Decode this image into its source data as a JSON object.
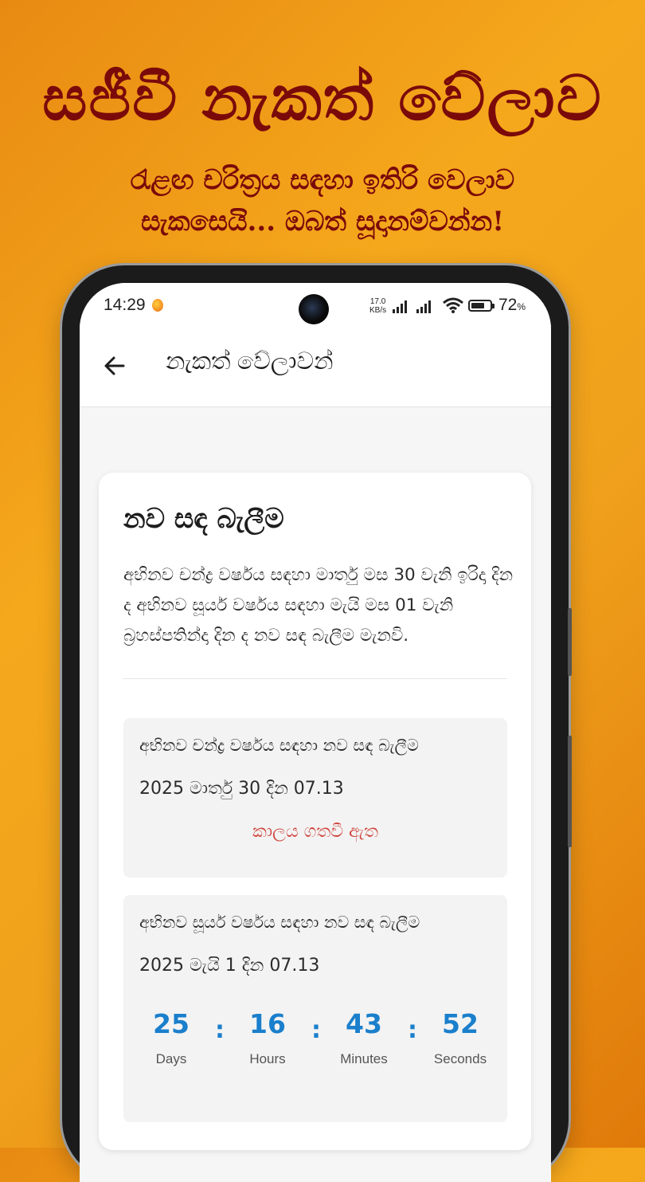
{
  "promo": {
    "title": "සජීවී නැකත් වේලාව",
    "subtitle_line1": "රැළඟ චරිත්‍රය සඳහා ඉතිරි වෙලාව",
    "subtitle_line2": "සැකසෙයි... ඔබත් සූදානම්වන්න!"
  },
  "status_bar": {
    "time": "14:29",
    "net_speed_value": "17.0",
    "net_speed_unit": "KB/s",
    "battery_percent": "72",
    "battery_percent_sign": "%",
    "battery_level": 0.72
  },
  "app_bar": {
    "title": "නැකත් වේලාවන්",
    "back_icon": "arrow-left-icon"
  },
  "card": {
    "title": "නව සඳ බැලීම",
    "description": "අභිනව චන්ද්‍ර වර්ෂය සඳහා මාර්තු මස 30 වැනි ඉරිදා දින ද අභිනව සූර්ය වර්ෂය සඳහා මැයි මස 01 වැනි බ්‍රහස්පතින්දා දින ද නව සඳ බැලීම මැනවි.",
    "events": [
      {
        "title": "අභිනව චන්ද්‍ර වර්ෂය සඳහා නව සඳ බැලීම",
        "date": "2025 මාර්තු 30 දින 07.13",
        "status": "කාලය ගතවී ඇත"
      },
      {
        "title": "අභිනව සූර්ය වර්ෂය සඳහා නව සඳ බැලීම",
        "date": "2025 මැයි 1 දින 07.13",
        "countdown": {
          "days": "25",
          "days_label": "Days",
          "hours": "16",
          "hours_label": "Hours",
          "minutes": "43",
          "minutes_label": "Minutes",
          "seconds": "52",
          "seconds_label": "Seconds",
          "separator": ":"
        }
      }
    ]
  },
  "colors": {
    "promo_text": "#7a0a0a",
    "accent_blue": "#1a7fcc",
    "expired_red": "#d0453e",
    "background_orange": "#f0a11c"
  }
}
